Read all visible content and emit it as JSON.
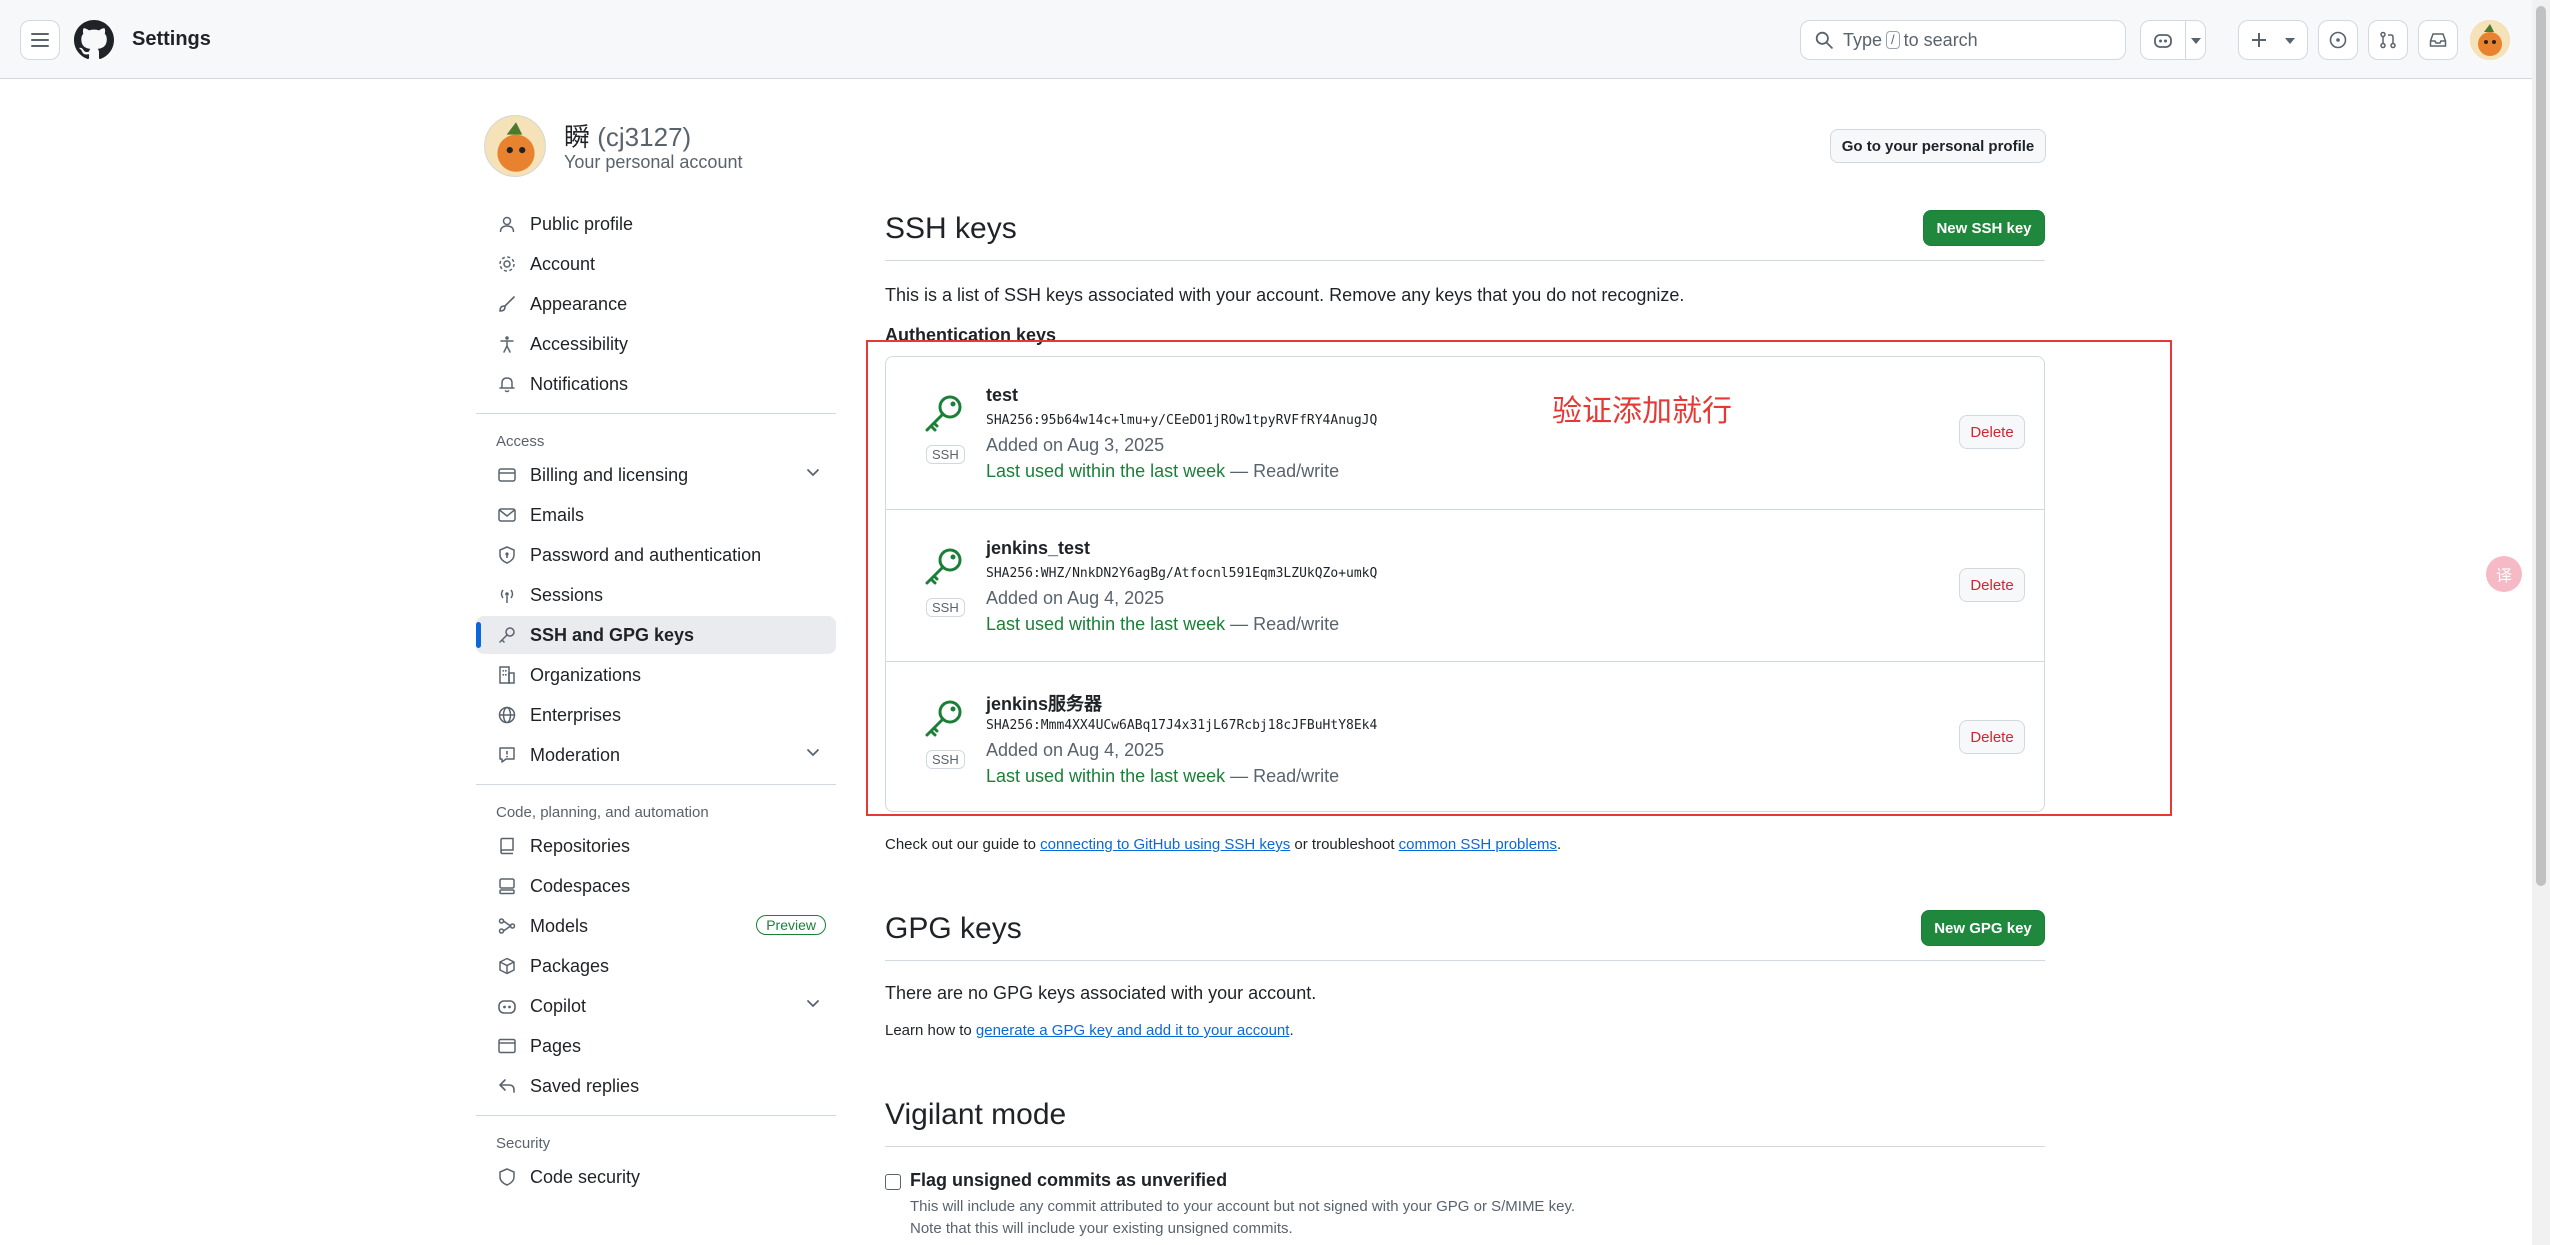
{
  "header": {
    "title": "Settings",
    "search_pre": "Type",
    "search_key": "/",
    "search_post": "to search"
  },
  "profile": {
    "name": "瞬",
    "login": "(cj3127)",
    "subtitle": "Your personal account",
    "go_profile_label": "Go to your personal profile"
  },
  "sidebar": {
    "group1": [
      {
        "label": "Public profile",
        "icon": "person-icon"
      },
      {
        "label": "Account",
        "icon": "gear-icon"
      },
      {
        "label": "Appearance",
        "icon": "paintbrush-icon"
      },
      {
        "label": "Accessibility",
        "icon": "accessibility-icon"
      },
      {
        "label": "Notifications",
        "icon": "bell-icon"
      }
    ],
    "access_heading": "Access",
    "access": [
      {
        "label": "Billing and licensing",
        "icon": "credit-card-icon"
      },
      {
        "label": "Emails",
        "icon": "mail-icon"
      },
      {
        "label": "Password and authentication",
        "icon": "shield-lock-icon"
      },
      {
        "label": "Sessions",
        "icon": "broadcast-icon"
      },
      {
        "label": "SSH and GPG keys",
        "icon": "key-icon"
      },
      {
        "label": "Organizations",
        "icon": "organization-icon"
      },
      {
        "label": "Enterprises",
        "icon": "globe-icon"
      },
      {
        "label": "Moderation",
        "icon": "report-icon"
      }
    ],
    "code_heading": "Code, planning, and automation",
    "code": [
      {
        "label": "Repositories",
        "icon": "repo-icon"
      },
      {
        "label": "Codespaces",
        "icon": "codespaces-icon"
      },
      {
        "label": "Models",
        "icon": "models-icon",
        "badge": "Preview"
      },
      {
        "label": "Packages",
        "icon": "package-icon"
      },
      {
        "label": "Copilot",
        "icon": "copilot-icon"
      },
      {
        "label": "Pages",
        "icon": "browser-icon"
      },
      {
        "label": "Saved replies",
        "icon": "reply-icon"
      }
    ],
    "security_heading": "Security",
    "security": [
      {
        "label": "Code security",
        "icon": "shield-icon"
      }
    ]
  },
  "ssh": {
    "title": "SSH keys",
    "new_label": "New SSH key",
    "description": "This is a list of SSH keys associated with your account. Remove any keys that you do not recognize.",
    "auth_heading": "Authentication keys",
    "ssh_label": "SSH",
    "delete_label": "Delete",
    "keys": [
      {
        "title": "test",
        "fingerprint": "SHA256:95b64w14c+lmu+y/CEeDO1jROw1tpyRVFfRY4AnugJQ",
        "added": "Added on Aug 3, 2025",
        "used": "Last used within the last week",
        "access": " — Read/write"
      },
      {
        "title": "jenkins_test",
        "fingerprint": "SHA256:WHZ/NnkDN2Y6agBg/Atfocnl591Eqm3LZUkQZo+umkQ",
        "added": "Added on Aug 4, 2025",
        "used": "Last used within the last week",
        "access": " — Read/write"
      },
      {
        "title": "jenkins服务器",
        "fingerprint": "SHA256:Mmm4XX4UCw6ABq17J4x31jL67Rcbj18cJFBuHtY8Ek4",
        "added": "Added on Aug 4, 2025",
        "used": "Last used within the last week",
        "access": " — Read/write"
      }
    ],
    "guide_pre": "Check out our guide to ",
    "guide_link1": "connecting to GitHub using SSH keys",
    "guide_mid": " or troubleshoot ",
    "guide_link2": "common SSH problems",
    "guide_post": "."
  },
  "annotation": "验证添加就行",
  "gpg": {
    "title": "GPG keys",
    "new_label": "New GPG key",
    "empty": "There are no GPG keys associated with your account.",
    "learn_pre": "Learn how to ",
    "learn_link": "generate a GPG key and add it to your account",
    "learn_post": "."
  },
  "vigilant": {
    "title": "Vigilant mode",
    "checkbox_label": "Flag unsigned commits as unverified",
    "help1": "This will include any commit attributed to your account but not signed with your GPG or S/MIME key.",
    "help2": "Note that this will include your existing unsigned commits."
  },
  "translate_fab": "译",
  "colors": {
    "accent": "#0969da",
    "primary_button": "#1f883d",
    "success_text": "#1a7f37",
    "danger_text": "#d1242f",
    "annotation": "#e53935"
  }
}
